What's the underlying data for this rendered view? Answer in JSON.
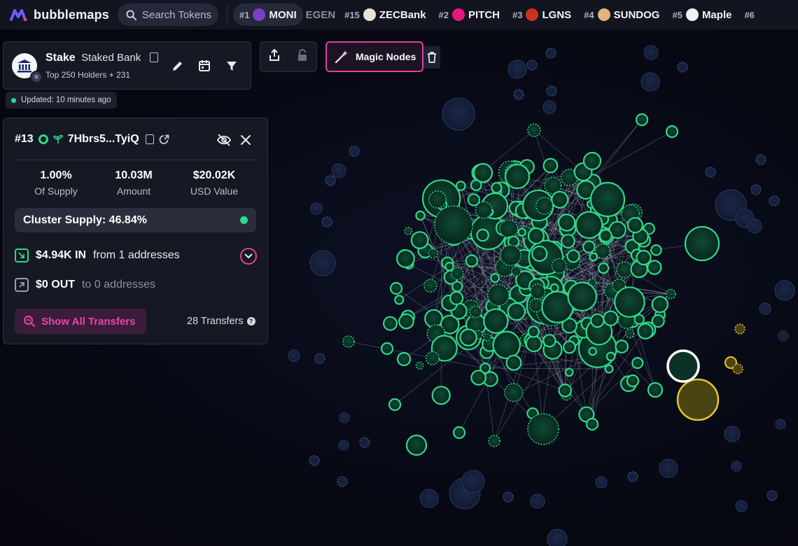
{
  "app": {
    "name": "bubblemaps"
  },
  "search": {
    "placeholder": "Search Tokens"
  },
  "ticker": [
    {
      "rank": "#1",
      "name": "MONI",
      "logo_color": "#7b3fc9",
      "active": true
    },
    {
      "rank": "",
      "name": "EGEN",
      "logo_color": "",
      "faded": true
    },
    {
      "rank": "#15",
      "name": "ZECBank",
      "logo_color": "#e8e2d6"
    },
    {
      "rank": "#2",
      "name": "PITCH",
      "logo_color": "#e8177f"
    },
    {
      "rank": "#3",
      "name": "LGNS",
      "logo_color": "#c8341e"
    },
    {
      "rank": "#4",
      "name": "SUNDOG",
      "logo_color": "#e0b47a"
    },
    {
      "rank": "#5",
      "name": "Maple",
      "logo_color": "#f2f2f2"
    },
    {
      "rank": "#6",
      "name": "",
      "logo_color": ""
    }
  ],
  "token": {
    "symbol": "Stake",
    "name": "Staked Bank",
    "holders": "Top 250 Holders + 231"
  },
  "status": {
    "updated": "Updated: 10 minutes ago"
  },
  "magic": {
    "label": "Magic Nodes"
  },
  "wallet": {
    "rank": "#13",
    "address": "7Hbrs5...TyiQ",
    "stats": [
      {
        "value": "1.00%",
        "label": "Of Supply"
      },
      {
        "value": "10.03M",
        "label": "Amount"
      },
      {
        "value": "$20.02K",
        "label": "USD Value"
      }
    ],
    "cluster_supply": "Cluster Supply: 46.84%",
    "in": {
      "amount": "$4.94K IN",
      "text": "from 1 addresses"
    },
    "out": {
      "amount": "$0 OUT",
      "text": "to 0 addresses"
    },
    "show_all": "Show All Transfers",
    "transfers": "28 Transfers"
  },
  "colors": {
    "accent": "#e040a0",
    "cluster_green": "#2fd98a",
    "highlight_yellow": "#e8c531",
    "background": "#070914"
  }
}
